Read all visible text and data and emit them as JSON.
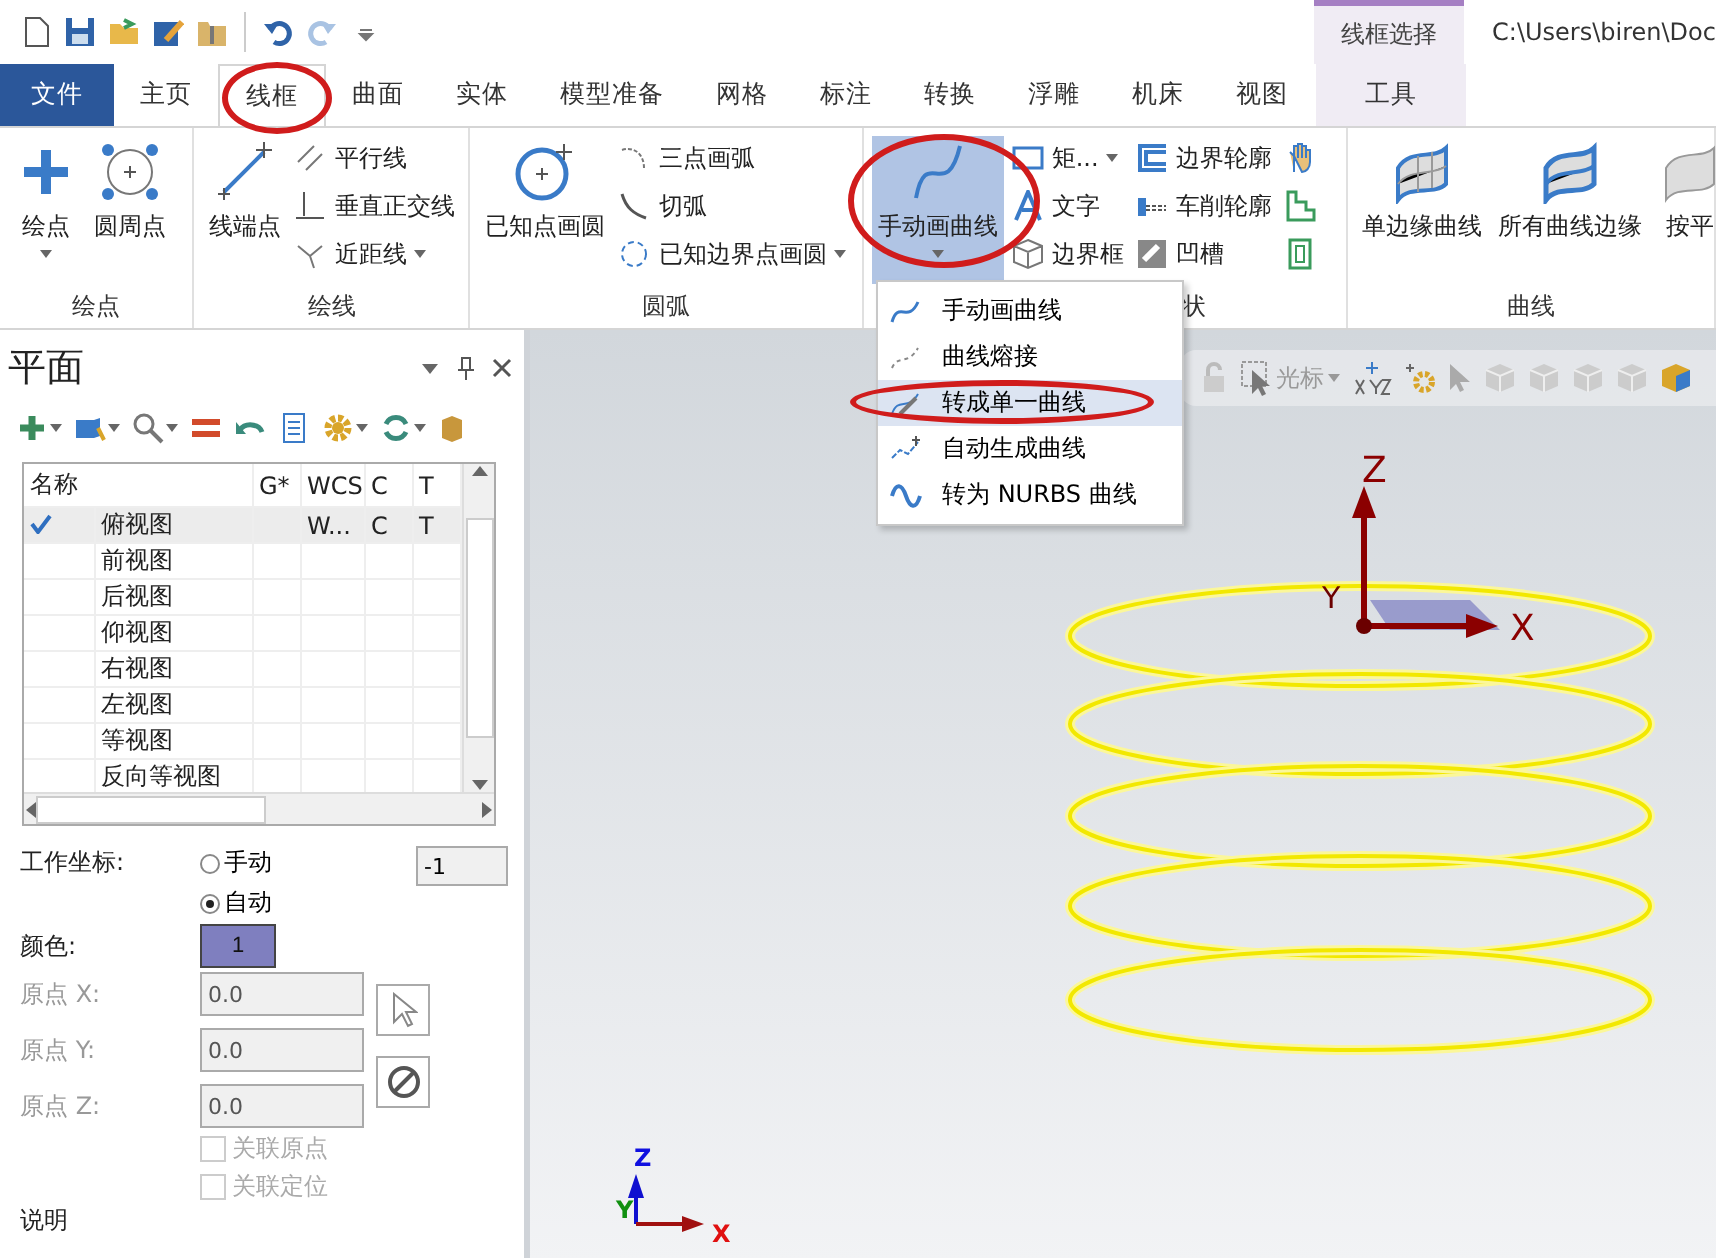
{
  "window": {
    "title": "C:\\Users\\biren\\Doc"
  },
  "context_tab_group": {
    "label": "线框选择"
  },
  "ribbon_tabs": [
    {
      "label": "文件",
      "kind": "file",
      "selected": false
    },
    {
      "label": "主页",
      "kind": "normal",
      "selected": false
    },
    {
      "label": "线框",
      "kind": "normal",
      "selected": true
    },
    {
      "label": "曲面",
      "kind": "normal",
      "selected": false
    },
    {
      "label": "实体",
      "kind": "normal",
      "selected": false
    },
    {
      "label": "模型准备",
      "kind": "normal",
      "selected": false
    },
    {
      "label": "网格",
      "kind": "normal",
      "selected": false
    },
    {
      "label": "标注",
      "kind": "normal",
      "selected": false
    },
    {
      "label": "转换",
      "kind": "normal",
      "selected": false
    },
    {
      "label": "浮雕",
      "kind": "normal",
      "selected": false
    },
    {
      "label": "机床",
      "kind": "normal",
      "selected": false
    },
    {
      "label": "视图",
      "kind": "normal",
      "selected": false
    },
    {
      "label": "工具",
      "kind": "context",
      "selected": false
    }
  ],
  "ribbon_groups": [
    {
      "label": "绘点",
      "items": [
        {
          "kind": "large",
          "label": "绘点",
          "dropdown": true,
          "selected": false
        },
        {
          "kind": "large",
          "label": "圆周点",
          "dropdown": false,
          "selected": false
        }
      ]
    },
    {
      "label": "绘线",
      "items": [
        {
          "kind": "large",
          "label": "线端点",
          "dropdown": false,
          "selected": false
        },
        {
          "kind": "stack",
          "buttons": [
            {
              "kind": "text",
              "label": "平行线",
              "dropdown": false
            },
            {
              "kind": "text",
              "label": "垂直正交线",
              "dropdown": false
            },
            {
              "kind": "text",
              "label": "近距线",
              "dropdown": true
            }
          ]
        }
      ]
    },
    {
      "label": "圆弧",
      "items": [
        {
          "kind": "large",
          "label": "已知点画圆",
          "dropdown": false,
          "selected": false
        },
        {
          "kind": "stack",
          "buttons": [
            {
              "kind": "text",
              "label": "三点画弧",
              "dropdown": false
            },
            {
              "kind": "text",
              "label": "切弧",
              "dropdown": false
            },
            {
              "kind": "text",
              "label": "已知边界点画圆",
              "dropdown": true
            }
          ]
        }
      ]
    },
    {
      "label": "状",
      "items": [
        {
          "kind": "large",
          "label": "手动画曲线",
          "dropdown": true,
          "selected": true
        },
        {
          "kind": "stack",
          "buttons": [
            {
              "kind": "text",
              "label": "矩...",
              "dropdown": true
            },
            {
              "kind": "text",
              "label": "文字",
              "dropdown": false
            },
            {
              "kind": "text",
              "label": "边界框",
              "dropdown": false
            }
          ]
        },
        {
          "kind": "stack",
          "buttons": [
            {
              "kind": "text",
              "label": "边界轮廓",
              "dropdown": false
            },
            {
              "kind": "text",
              "label": "车削轮廓",
              "dropdown": false
            },
            {
              "kind": "text",
              "label": "凹槽",
              "dropdown": false
            }
          ]
        },
        {
          "kind": "stack",
          "buttons": [
            {
              "kind": "icon"
            },
            {
              "kind": "icon"
            },
            {
              "kind": "icon"
            }
          ]
        }
      ]
    },
    {
      "label": "曲线",
      "items": [
        {
          "kind": "large",
          "label": "单边缘曲线",
          "dropdown": false,
          "selected": false
        },
        {
          "kind": "large",
          "label": "所有曲线边缘",
          "dropdown": false,
          "selected": false
        },
        {
          "kind": "large",
          "label": "按平",
          "dropdown": false,
          "selected": false
        }
      ]
    }
  ],
  "curve_menu": {
    "items": [
      {
        "label": "手动画曲线",
        "selected": false
      },
      {
        "label": "曲线熔接",
        "selected": false
      },
      {
        "label": "转成单一曲线",
        "selected": true
      },
      {
        "label": "自动生成曲线",
        "selected": false
      },
      {
        "label": "转为 NURBS 曲线",
        "selected": false
      }
    ]
  },
  "planes_panel": {
    "title": "平面",
    "table": {
      "columns": [
        "名称",
        "G*",
        "WCS",
        "C",
        "T"
      ],
      "rows": [
        {
          "checked": true,
          "selected": true,
          "name": "俯视图",
          "wcs": "W...",
          "c": "C",
          "t": "T"
        },
        {
          "checked": false,
          "selected": false,
          "name": "前视图"
        },
        {
          "checked": false,
          "selected": false,
          "name": "后视图"
        },
        {
          "checked": false,
          "selected": false,
          "name": "仰视图"
        },
        {
          "checked": false,
          "selected": false,
          "name": "右视图"
        },
        {
          "checked": false,
          "selected": false,
          "name": "左视图"
        },
        {
          "checked": false,
          "selected": false,
          "name": "等视图"
        },
        {
          "checked": false,
          "selected": false,
          "name": "反向等视图"
        }
      ]
    },
    "work_coordinate": {
      "label": "工作坐标:",
      "options": [
        {
          "label": "手动",
          "selected": false
        },
        {
          "label": "自动",
          "selected": true
        }
      ],
      "value": "-1"
    },
    "color_field": {
      "label": "颜色:",
      "value": "1"
    },
    "origin_fields": [
      {
        "label": "原点 X:",
        "value": "0.0",
        "disabled": true
      },
      {
        "label": "原点 Y:",
        "value": "0.0",
        "disabled": true
      },
      {
        "label": "原点 Z:",
        "value": "0.0",
        "disabled": true
      }
    ],
    "checkboxes": [
      {
        "label": "关联原点",
        "checked": false,
        "disabled": true
      },
      {
        "label": "关联定位",
        "checked": false,
        "disabled": true
      }
    ],
    "description_label": "说明"
  },
  "viewport": {
    "cursor_label": "光标",
    "axes": {
      "x": "X",
      "y": "Y",
      "z": "Z"
    },
    "triad": {
      "x": "X",
      "y": "Y",
      "z": "Z"
    }
  }
}
